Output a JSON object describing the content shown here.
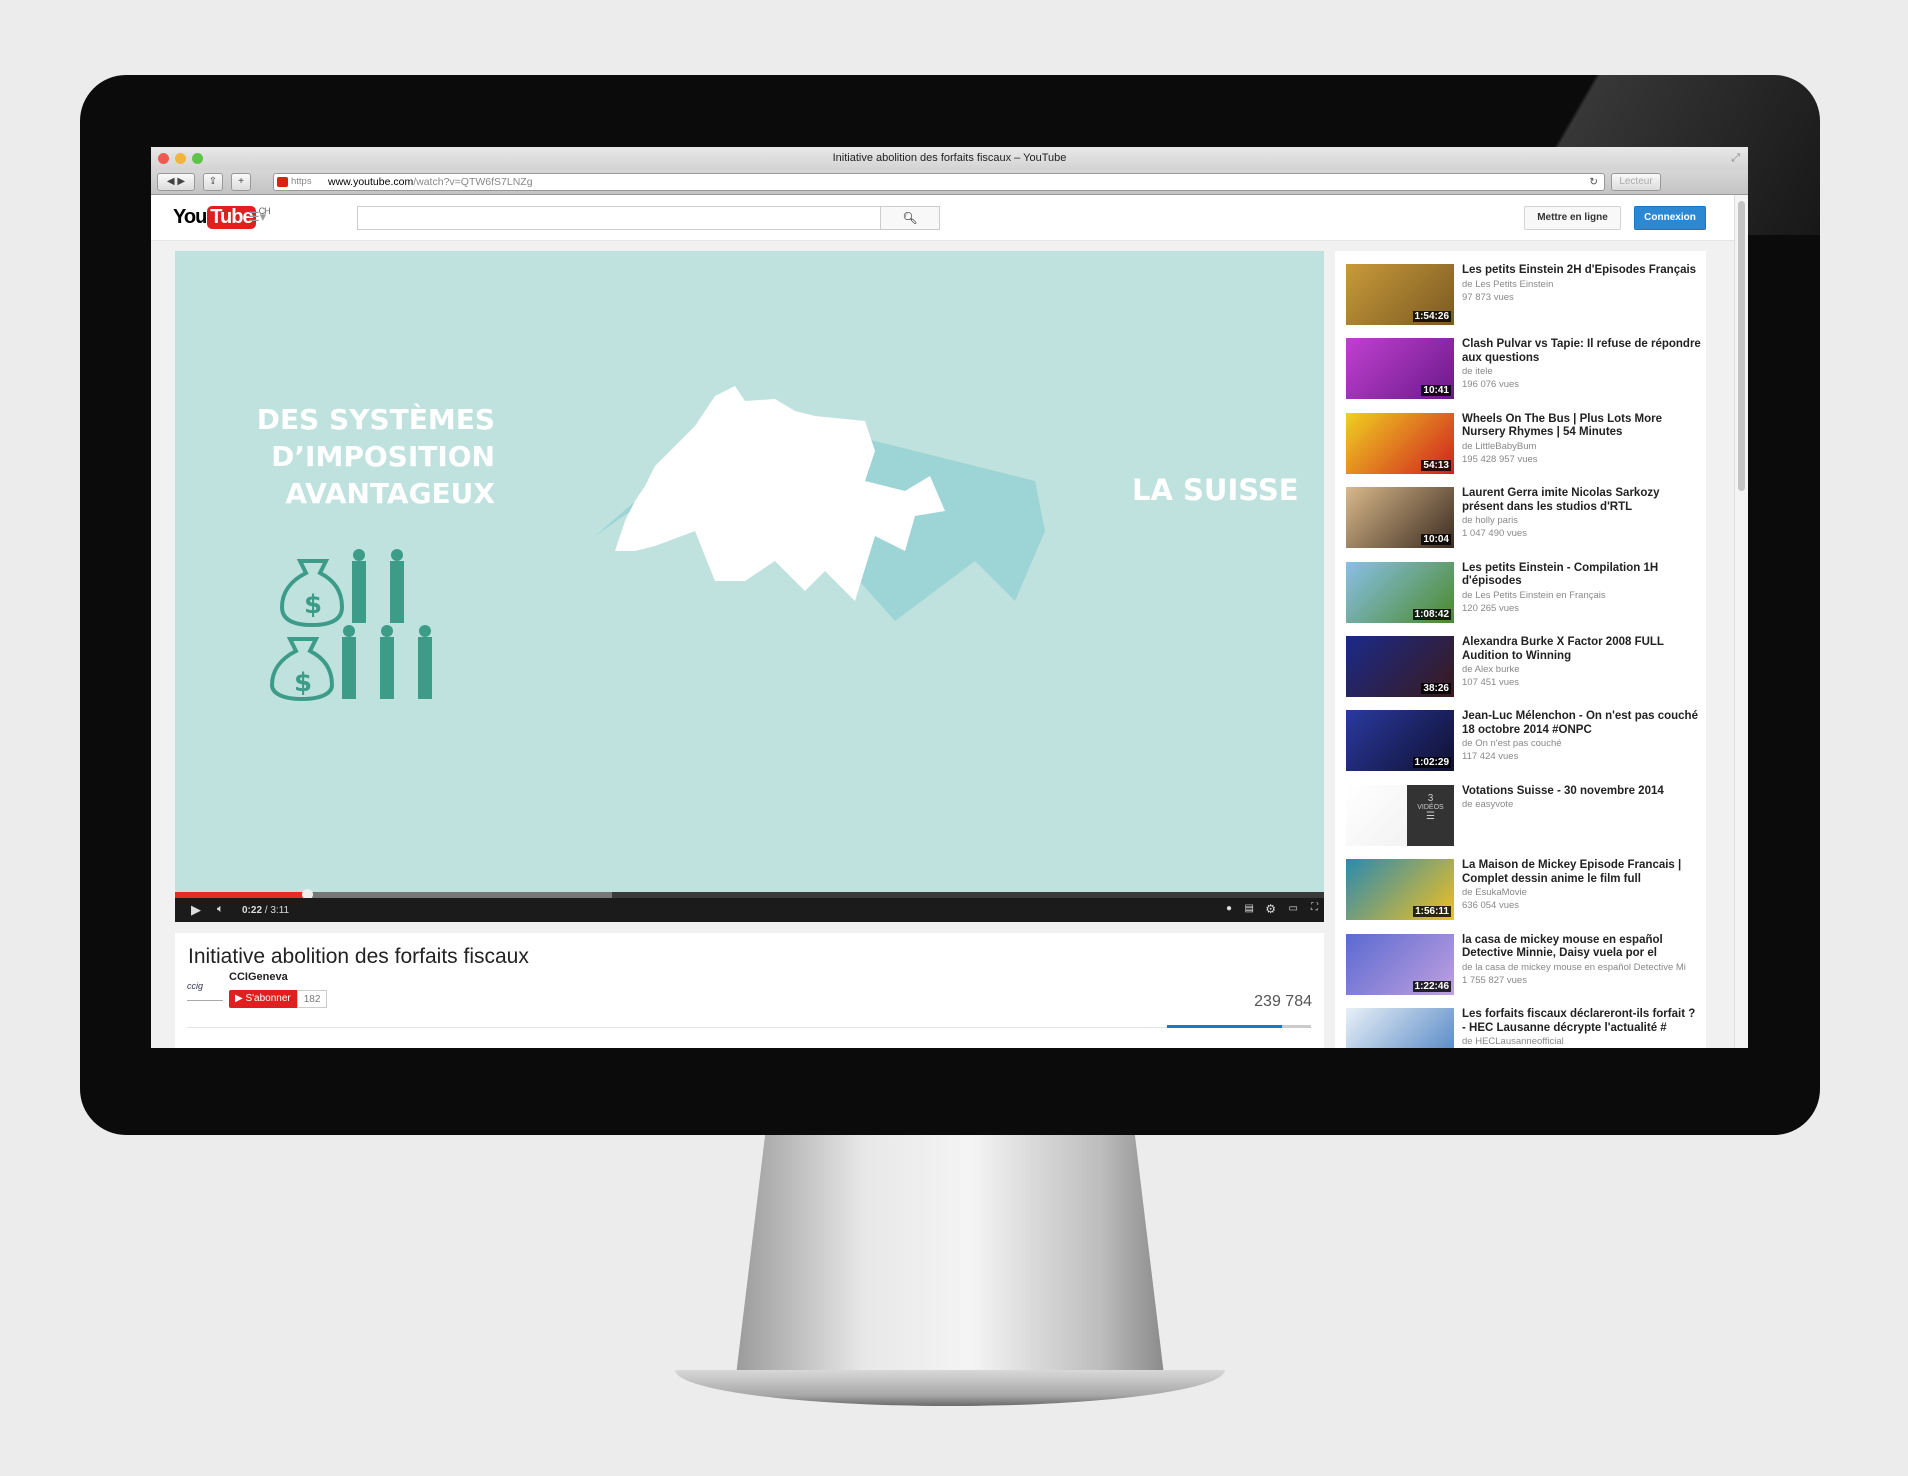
{
  "browser": {
    "title": "Initiative abolition des forfaits fiscaux – YouTube",
    "url_scheme": "https",
    "url_host": "www.youtube.com",
    "url_path": "/watch?v=QTW6fS7LNZg",
    "reader": "Lecteur"
  },
  "header": {
    "logo_you": "You",
    "logo_tube": "Tube",
    "country": "CH",
    "upload": "Mettre en ligne",
    "signin": "Connexion",
    "search_placeholder": ""
  },
  "video": {
    "left_text": [
      "DES SYSTÈMES",
      "D’IMPOSITION",
      "AVANTAGEUX"
    ],
    "right_text": "LA SUISSE",
    "current_time": "0:22",
    "duration": "3:11",
    "played_fraction": 0.115,
    "buffered_fraction": 0.38,
    "background": "#bfe2de",
    "accent": "#e52d27"
  },
  "info": {
    "title": "Initiative abolition des forfaits fiscaux",
    "channel": "CCIGeneva",
    "avatar_text": "ccig",
    "subscribe": "S'abonner",
    "subscribers": "182",
    "views": "239 784",
    "like_fraction": 0.8
  },
  "sidebar": {
    "items": [
      {
        "title": "Les petits Einstein 2H d'Episodes Français",
        "channel": "de Les Petits Einstein",
        "views": "97 873 vues",
        "duration": "1:54:26",
        "colors": [
          "#c99a3a",
          "#7a5a22"
        ]
      },
      {
        "title": "Clash Pulvar vs Tapie: Il refuse de répondre aux questions",
        "channel": "de itele",
        "views": "196 076 vues",
        "duration": "10:41",
        "colors": [
          "#c040d0",
          "#6a1a8a"
        ]
      },
      {
        "title": "Wheels On The Bus | Plus Lots More Nursery Rhymes | 54 Minutes",
        "channel": "de LittleBabyBum",
        "views": "195 428 957 vues",
        "duration": "54:13",
        "colors": [
          "#f0d020",
          "#d02020"
        ]
      },
      {
        "title": "Laurent Gerra imite Nicolas Sarkozy présent dans les studios d'RTL",
        "channel": "de holly paris",
        "views": "1 047 490 vues",
        "duration": "10:04",
        "colors": [
          "#d9b98a",
          "#3a2a20"
        ]
      },
      {
        "title": "Les petits Einstein - Compilation 1H d'épisodes",
        "channel": "de Les Petits Einstein en Français",
        "views": "120 265 vues",
        "duration": "1:08:42",
        "colors": [
          "#8ac0e8",
          "#4a8a2a"
        ]
      },
      {
        "title": "Alexandra Burke X Factor 2008 FULL Audition to Winning",
        "channel": "de Alex burke",
        "views": "107 451 vues",
        "duration": "38:26",
        "colors": [
          "#1a2a8a",
          "#3a1a1a"
        ]
      },
      {
        "title": "Jean-Luc Mélenchon - On n'est pas couché 18 octobre 2014 #ONPC",
        "channel": "de On n'est pas couché",
        "views": "117 424 vues",
        "duration": "1:02:29",
        "colors": [
          "#2a3aa0",
          "#101030"
        ]
      },
      {
        "title": "Votations Suisse - 30 novembre 2014",
        "channel": "de easyvote",
        "views": "",
        "duration": "",
        "playlist_count": "3",
        "playlist_label": "VIDÉOS",
        "colors": [
          "#ffffff",
          "#eeeeee"
        ]
      },
      {
        "title": "La Maison de Mickey Episode Francais | Complet dessin anime le film full",
        "channel": "de EsukaMovie",
        "views": "636 054 vues",
        "duration": "1:56:11",
        "colors": [
          "#2a8ab0",
          "#f0c020"
        ]
      },
      {
        "title": "la casa de mickey mouse en español Detective Minnie, Daisy vuela por el",
        "channel": "de la casa de mickey mouse en español Detective Mi",
        "views": "1 755 827 vues",
        "duration": "1:22:46",
        "colors": [
          "#5a6ad0",
          "#c0a0e0"
        ]
      },
      {
        "title": "Les forfaits fiscaux déclareront-ils forfait ? - HEC Lausanne décrypte l'actualité #",
        "channel": "de HECLausanneofficial",
        "views": "",
        "duration": "",
        "colors": [
          "#e8f0f8",
          "#4a80c0"
        ]
      }
    ]
  }
}
